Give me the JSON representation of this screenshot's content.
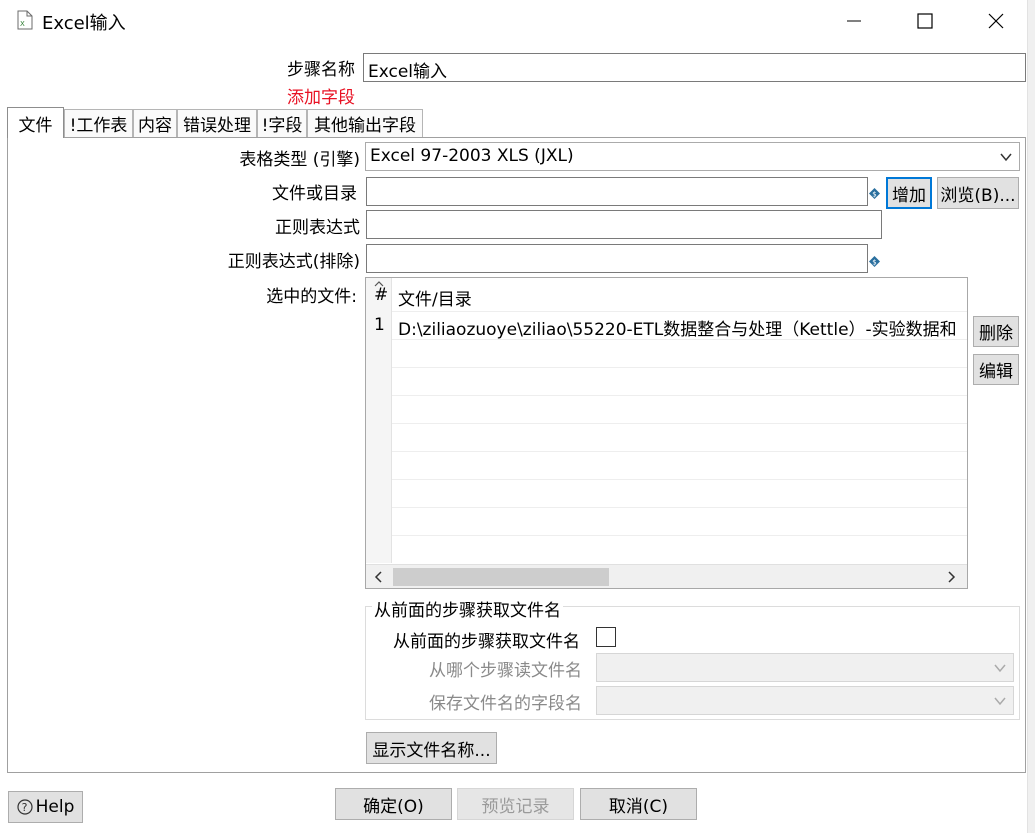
{
  "window": {
    "title": "Excel输入",
    "icon": "excel-file-icon",
    "controls": [
      "minimize-icon",
      "maximize-icon",
      "close-icon"
    ]
  },
  "step": {
    "name_label": "步骤名称",
    "name_value": "Excel输入",
    "add_field_link": "添加字段"
  },
  "tabs": [
    {
      "label": "文件",
      "active": true
    },
    {
      "label": "!工作表",
      "active": false
    },
    {
      "label": "内容",
      "active": false
    },
    {
      "label": "错误处理",
      "active": false
    },
    {
      "label": "!字段",
      "active": false
    },
    {
      "label": "其他输出字段",
      "active": false
    }
  ],
  "file_tab": {
    "sheet_type_label": "表格类型 (引擎)",
    "sheet_type_value": "Excel 97-2003 XLS (JXL)",
    "file_dir_label": "文件或目录",
    "file_dir_value": "",
    "add_button": "增加",
    "browse_button": "浏览(B)...",
    "regex_label": "正则表达式",
    "regex_value": "",
    "regex_exclude_label": "正则表达式(排除)",
    "regex_exclude_value": "",
    "selected_files_label": "选中的文件:",
    "table": {
      "columns": [
        "#",
        "文件/目录"
      ],
      "rows": [
        {
          "index": "1",
          "path": "D:\\ziliaozuoye\\ziliao\\55220-ETL数据整合与处理（Kettle）-实验数据和"
        }
      ]
    },
    "delete_button": "删除",
    "edit_button": "编辑",
    "prev_step_group": {
      "title": "从前面的步骤获取文件名",
      "checkbox_label": "从前面的步骤获取文件名",
      "checkbox_checked": false,
      "read_step_label": "从哪个步骤读文件名",
      "read_step_value": "",
      "field_label": "保存文件名的字段名",
      "field_value": ""
    },
    "show_filenames_button": "显示文件名称..."
  },
  "footer": {
    "help_button": "Help",
    "ok_button": "确定(O)",
    "preview_button": "预览记录",
    "cancel_button": "取消(C)"
  },
  "colors": {
    "accent": "#0078d7",
    "link_red": "#e81123"
  }
}
